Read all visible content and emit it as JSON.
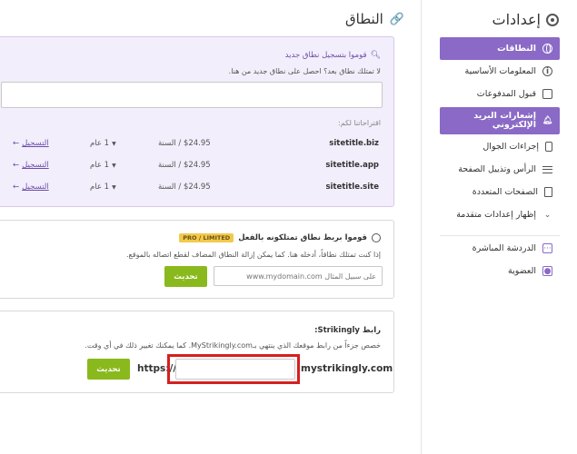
{
  "sidebar": {
    "title": "إعدادات",
    "items": [
      {
        "label": "النطاقات",
        "icon": "globe-icon",
        "active": true
      },
      {
        "label": "المعلومات الأساسية",
        "icon": "info-icon"
      },
      {
        "label": "قبول المدفوعات",
        "icon": "payment-icon"
      },
      {
        "label": "إشعارات البريد الإلكتروني",
        "icon": "bell-icon",
        "active": true
      },
      {
        "label": "إجراءات الجوال",
        "icon": "phone-icon"
      },
      {
        "label": "الرأس وتذييل الصفحة",
        "icon": "header-footer-icon"
      },
      {
        "label": "الصفحات المتعددة",
        "icon": "pages-icon"
      },
      {
        "label": "إظهار إعدادات متقدمة",
        "icon": "chevron-down-icon"
      },
      {
        "label": "الدردشة المباشرة",
        "icon": "chat-icon"
      },
      {
        "label": "العضوية",
        "icon": "membership-icon"
      }
    ]
  },
  "main": {
    "title": "النطاق",
    "register": {
      "title": "قوموا بتسجيل نطاق جديد",
      "subtitle": "لا تمتلك نطاق بعد؟ احصل على نطاق جديد من هنا.",
      "search_value": "",
      "suggestions_label": "اقتراحاتنا لكم:",
      "rows": [
        {
          "domain": "sitetitle.biz",
          "price": "$24.95 / السنة",
          "term": "1 عام",
          "action": "التسجيل"
        },
        {
          "domain": "sitetitle.app",
          "price": "$24.95 / السنة",
          "term": "1 عام",
          "action": "التسجيل"
        },
        {
          "domain": "sitetitle.site",
          "price": "$24.95 / السنة",
          "term": "1 عام",
          "action": "التسجيل"
        }
      ]
    },
    "connect": {
      "title": "قوموا بربط نطاق تمتلكونه بالفعل",
      "badge": "PRO / LIMITED",
      "subtitle": "إذا كنت تمتلك نطاقاً، أدخله هنا. كما يمكن إزالة النطاق المضاف لقطع اتصاله بالموقع.",
      "placeholder": "على سبيل المثال www.mydomain.com",
      "button": "تحديث"
    },
    "strikingly": {
      "title": "رابط Strikingly:",
      "subtitle": "خصص جزءاً من رابط موقعك الذي ينتهي بـMyStrikingly.com. كما يمكنك تغيير ذلك في أي وقت.",
      "prefix": "https://",
      "suffix": "mystrikingly.com",
      "value": "",
      "button": "تحديث"
    }
  },
  "colors": {
    "accent": "#8a6ac6",
    "button": "#8ab91d",
    "highlight": "#d61f1f",
    "badge": "#f2c94c"
  }
}
